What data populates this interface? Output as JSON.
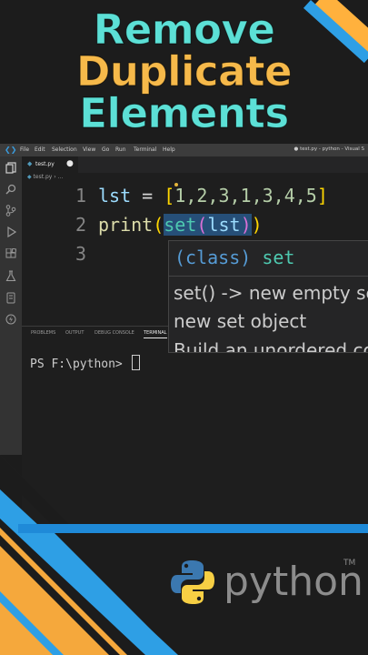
{
  "title": {
    "line1": "Remove",
    "line2": "Duplicate",
    "line3": "Elements"
  },
  "colors": {
    "teal": "#5ce0d6",
    "orange": "#f6b94a",
    "blue": "#1f8ad8"
  },
  "menu": {
    "items": [
      "File",
      "Edit",
      "Selection",
      "View",
      "Go",
      "Run",
      "Terminal",
      "Help"
    ],
    "window_title": "● test.py - python - Visual S"
  },
  "activity_icons": [
    "explorer-icon",
    "search-icon",
    "source-control-icon",
    "run-debug-icon",
    "extensions-icon",
    "testing-icon",
    "remote-icon",
    "lightning-icon"
  ],
  "tab": {
    "name": "test.py",
    "modified": "●"
  },
  "breadcrumb": {
    "file": "test.py",
    "sep": " › ..."
  },
  "editor": {
    "lines": [
      {
        "num": "1",
        "var": "lst",
        "eq": " = ",
        "open": "[",
        "nums": "1,2,3,1,3,4,5",
        "close": "]"
      },
      {
        "num": "2",
        "fn": "print",
        "open": "(",
        "cls": "set",
        "open2": "(",
        "arg": "lst",
        "close2": ")",
        "close": ")"
      },
      {
        "num": "3"
      }
    ]
  },
  "hover": {
    "kw": "(class)",
    "name": "set",
    "line1": "set() -> new empty set object",
    "line2": "new set object",
    "line3": "Build an unordered collection"
  },
  "panel": {
    "tabs": [
      "PROBLEMS",
      "OUTPUT",
      "DEBUG CONSOLE",
      "TERMINAL"
    ],
    "active": "TERMINAL"
  },
  "terminal": {
    "prompt": "PS F:\\python> "
  },
  "logo": {
    "word": "python",
    "tm": "TM"
  }
}
